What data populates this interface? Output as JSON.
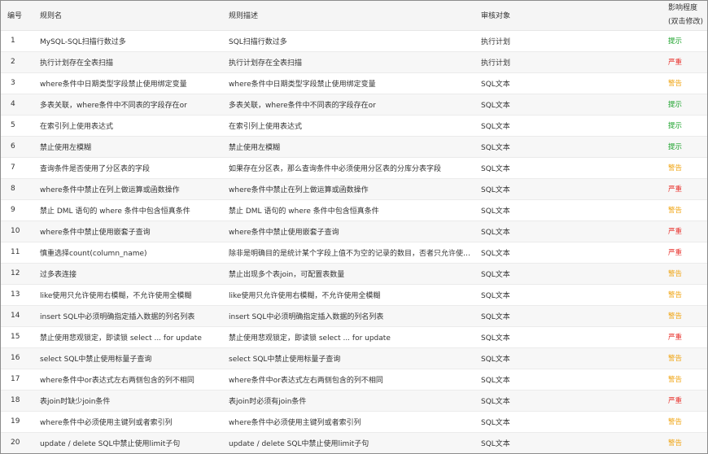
{
  "colors": {
    "提示": "#19a128",
    "严重": "#e8322c",
    "警告": "#f0a514"
  },
  "table": {
    "headers": {
      "id": "编号",
      "name": "规则名",
      "desc": "规则描述",
      "target": "审核对象",
      "impact_line1": "影响程度",
      "impact_line2": "(双击修改)"
    },
    "rows": [
      {
        "id": "1",
        "name": "MySQL-SQL扫描行数过多",
        "desc": "SQL扫描行数过多",
        "target": "执行计划",
        "impact": "提示"
      },
      {
        "id": "2",
        "name": "执行计划存在全表扫描",
        "desc": "执行计划存在全表扫描",
        "target": "执行计划",
        "impact": "严重"
      },
      {
        "id": "3",
        "name": "where条件中日期类型字段禁止使用绑定变量",
        "desc": "where条件中日期类型字段禁止使用绑定变量",
        "target": "SQL文本",
        "impact": "警告"
      },
      {
        "id": "4",
        "name": "多表关联，where条件中不同表的字段存在or",
        "desc": "多表关联，where条件中不同表的字段存在or",
        "target": "SQL文本",
        "impact": "提示"
      },
      {
        "id": "5",
        "name": "在索引列上使用表达式",
        "desc": "在索引列上使用表达式",
        "target": "SQL文本",
        "impact": "提示"
      },
      {
        "id": "6",
        "name": "禁止使用左模糊",
        "desc": "禁止使用左模糊",
        "target": "SQL文本",
        "impact": "提示"
      },
      {
        "id": "7",
        "name": "查询条件是否使用了分区表的字段",
        "desc": "如果存在分区表，那么查询条件中必须使用分区表的分库分表字段",
        "target": "SQL文本",
        "impact": "警告"
      },
      {
        "id": "8",
        "name": "where条件中禁止在列上做运算或函数操作",
        "desc": "where条件中禁止在列上做运算或函数操作",
        "target": "SQL文本",
        "impact": "严重"
      },
      {
        "id": "9",
        "name": "禁止 DML 语句的 where 条件中包含恒真条件",
        "desc": "禁止 DML 语句的 where 条件中包含恒真条件",
        "target": "SQL文本",
        "impact": "警告"
      },
      {
        "id": "10",
        "name": "where条件中禁止使用嵌套子查询",
        "desc": "where条件中禁止使用嵌套子查询",
        "target": "SQL文本",
        "impact": "严重"
      },
      {
        "id": "11",
        "name": "慎重选择count(column_name)",
        "desc": "除非是明确目的是统计某个字段上值不为空的记录的数目，否者只允许使用 c...",
        "target": "SQL文本",
        "impact": "严重"
      },
      {
        "id": "12",
        "name": "过多表连接",
        "desc": "禁止出现多个表join，可配置表数量",
        "target": "SQL文本",
        "impact": "警告"
      },
      {
        "id": "13",
        "name": "like使用只允许使用右模糊，不允许使用全模糊",
        "desc": "like使用只允许使用右模糊，不允许使用全模糊",
        "target": "SQL文本",
        "impact": "警告"
      },
      {
        "id": "14",
        "name": "insert SQL中必须明确指定插入数据的列名列表",
        "desc": "insert SQL中必须明确指定插入数据的列名列表",
        "target": "SQL文本",
        "impact": "警告"
      },
      {
        "id": "15",
        "name": "禁止使用悲观锁定，即读锁 select ... for update",
        "desc": "禁止使用悲观锁定，即读锁 select ... for update",
        "target": "SQL文本",
        "impact": "严重"
      },
      {
        "id": "16",
        "name": "select SQL中禁止使用标量子查询",
        "desc": "select SQL中禁止使用标量子查询",
        "target": "SQL文本",
        "impact": "警告"
      },
      {
        "id": "17",
        "name": "where条件中or表达式左右两侧包含的列不相同",
        "desc": "where条件中or表达式左右两侧包含的列不相同",
        "target": "SQL文本",
        "impact": "警告"
      },
      {
        "id": "18",
        "name": "表join时缺少join条件",
        "desc": "表join时必须有join条件",
        "target": "SQL文本",
        "impact": "严重"
      },
      {
        "id": "19",
        "name": "where条件中必须使用主键列或者索引列",
        "desc": "where条件中必须使用主键列或者索引列",
        "target": "SQL文本",
        "impact": "警告"
      },
      {
        "id": "20",
        "name": "update / delete SQL中禁止使用limit子句",
        "desc": "update / delete SQL中禁止使用limit子句",
        "target": "SQL文本",
        "impact": "警告"
      }
    ]
  }
}
